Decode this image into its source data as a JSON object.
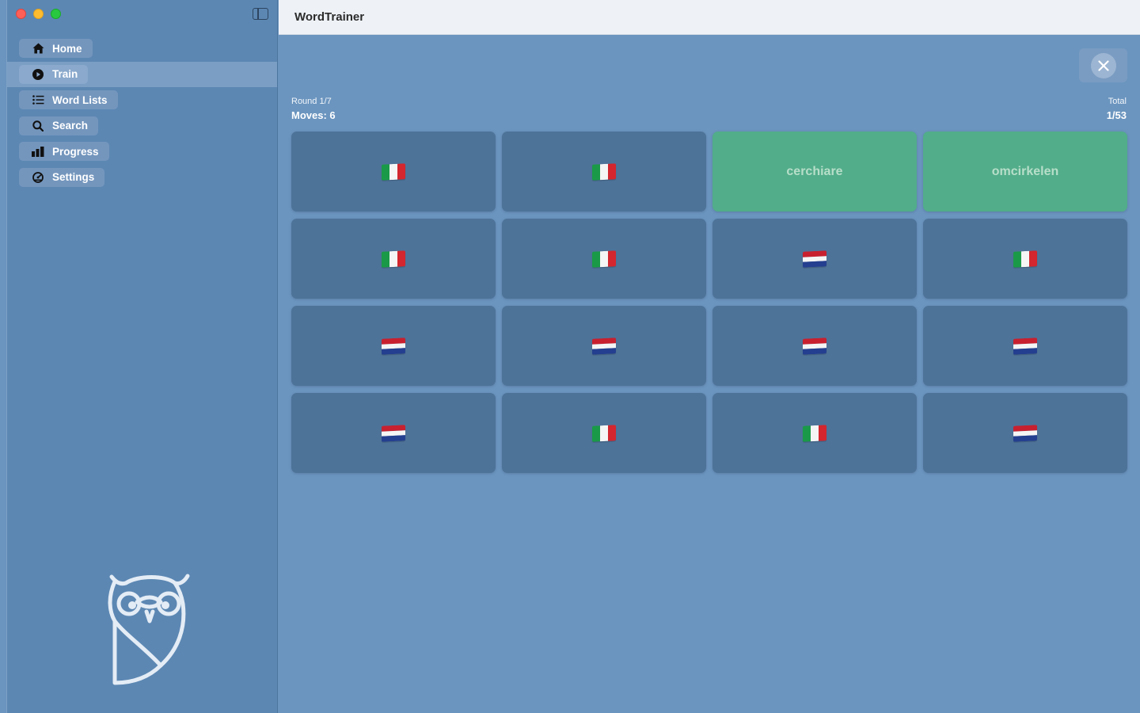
{
  "app": {
    "title": "WordTrainer"
  },
  "sidebar": {
    "items": [
      {
        "label": "Home",
        "icon": "house-icon",
        "selected": false
      },
      {
        "label": "Train",
        "icon": "play-circle-icon",
        "selected": true
      },
      {
        "label": "Word Lists",
        "icon": "list-icon",
        "selected": false
      },
      {
        "label": "Search",
        "icon": "magnifier-icon",
        "selected": false
      },
      {
        "label": "Progress",
        "icon": "bar-chart-icon",
        "selected": false
      },
      {
        "label": "Settings",
        "icon": "gauge-icon",
        "selected": false
      }
    ]
  },
  "game": {
    "round_label": "Round 1/7",
    "moves_label": "Moves: 6",
    "total_label": "Total",
    "total_value": "1/53",
    "cards": [
      {
        "type": "flag",
        "flag": "italy-flag-icon"
      },
      {
        "type": "flag",
        "flag": "italy-flag-icon"
      },
      {
        "type": "word",
        "text": "cerchiare",
        "matched": true
      },
      {
        "type": "word",
        "text": "omcirkelen",
        "matched": true
      },
      {
        "type": "flag",
        "flag": "italy-flag-icon"
      },
      {
        "type": "flag",
        "flag": "italy-flag-icon"
      },
      {
        "type": "flag",
        "flag": "netherlands-flag-icon"
      },
      {
        "type": "flag",
        "flag": "italy-flag-icon"
      },
      {
        "type": "flag",
        "flag": "netherlands-flag-icon"
      },
      {
        "type": "flag",
        "flag": "netherlands-flag-icon"
      },
      {
        "type": "flag",
        "flag": "netherlands-flag-icon"
      },
      {
        "type": "flag",
        "flag": "netherlands-flag-icon"
      },
      {
        "type": "flag",
        "flag": "netherlands-flag-icon"
      },
      {
        "type": "flag",
        "flag": "italy-flag-icon"
      },
      {
        "type": "flag",
        "flag": "italy-flag-icon"
      },
      {
        "type": "flag",
        "flag": "netherlands-flag-icon"
      }
    ]
  },
  "colors": {
    "background": "#6b95bf",
    "sidebar": "#5c87b3",
    "card": "#4e7399",
    "card_matched": "#52ad8a"
  }
}
